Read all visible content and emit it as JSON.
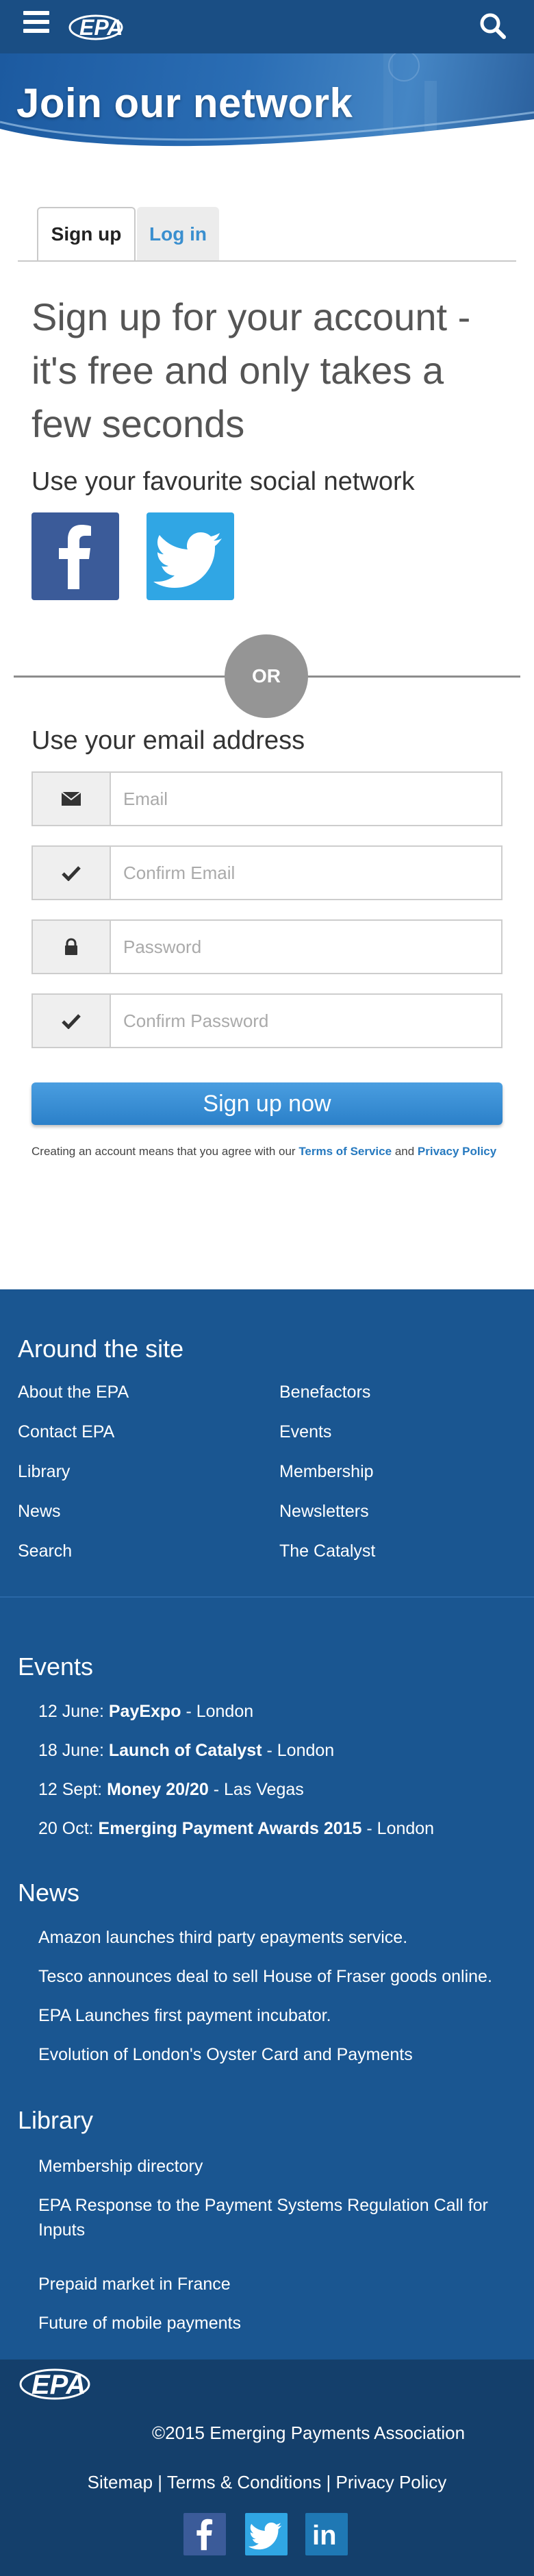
{
  "header": {
    "logo_text": "EPA",
    "menu_icon": "hamburger-menu-icon",
    "search_icon": "search-icon",
    "bar_color": "#1a4e84"
  },
  "hero": {
    "title": "Join our network"
  },
  "tabs": {
    "signup": "Sign up",
    "login": "Log in"
  },
  "form": {
    "headline": "Sign up for your account - it's free and only takes a few seconds",
    "social_heading": "Use your favourite social network",
    "or_label": "OR",
    "email_heading": "Use your email address",
    "fields": [
      {
        "icon": "envelope-icon",
        "placeholder": "Email"
      },
      {
        "icon": "check-icon",
        "placeholder": "Confirm Email"
      },
      {
        "icon": "lock-icon",
        "placeholder": "Password"
      },
      {
        "icon": "check-icon",
        "placeholder": "Confirm Password"
      }
    ],
    "submit_label": "Sign up now",
    "terms_prefix": "Creating an account means that you agree with our",
    "terms_link": "Terms of Service",
    "terms_and": "and",
    "privacy_link": "Privacy Policy"
  },
  "around": {
    "title": "Around the site",
    "left": [
      "About the EPA",
      "Contact EPA",
      "Library",
      "News",
      "Search"
    ],
    "right": [
      "Benefactors",
      "Events",
      "Membership",
      "Newsletters",
      "The Catalyst"
    ]
  },
  "events": {
    "title": "Events",
    "items": [
      {
        "date": "12 June:",
        "name": "PayExpo",
        "place": "- London"
      },
      {
        "date": "18 June:",
        "name": "Launch of Catalyst",
        "place": "- London"
      },
      {
        "date": "12 Sept:",
        "name": "Money 20/20",
        "place": "- Las Vegas"
      },
      {
        "date": "20 Oct:",
        "name": "Emerging Payment Awards 2015",
        "place": "- London"
      }
    ]
  },
  "news": {
    "title": "News",
    "items": [
      "Amazon launches third party epayments service.",
      "Tesco announces deal to sell House of Fraser goods online.",
      "EPA Launches first payment incubator.",
      "Evolution of London's Oyster Card and Payments"
    ]
  },
  "library": {
    "title": "Library",
    "items": [
      "Membership directory",
      "EPA Response to the Payment Systems Regulation Call for Inputs",
      "Prepaid market in France",
      "Future of mobile payments"
    ]
  },
  "footer": {
    "logo_text": "EPA",
    "copyright": "©2015 Emerging Payments Association",
    "links": [
      "Sitemap",
      "Terms & Conditions",
      "Privacy Policy"
    ],
    "separator": "|",
    "social_icons": [
      "facebook-icon",
      "twitter-icon",
      "linkedin-icon"
    ],
    "linkedin_text": "in"
  }
}
